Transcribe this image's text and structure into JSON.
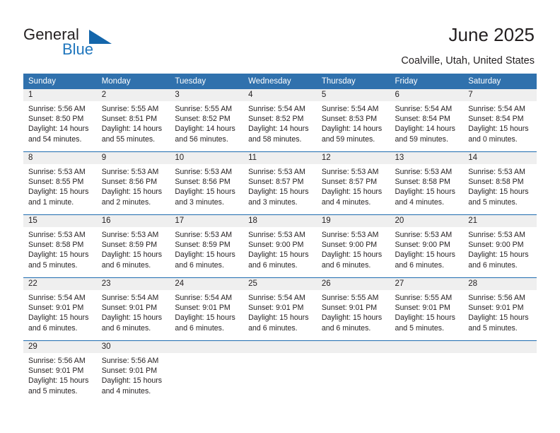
{
  "brand": {
    "name_part1": "General",
    "name_part2": "Blue",
    "triangle_color": "#1466ab",
    "blue_text_color": "#1f76bd"
  },
  "header": {
    "title": "June 2025",
    "location": "Coalville, Utah, United States"
  },
  "theme": {
    "header_row_bg": "#3071ad",
    "header_row_text": "#ffffff",
    "daynum_band_bg": "#efefef",
    "week_separator": "#1f6cb0",
    "body_text": "#231f20"
  },
  "calendar": {
    "weekday_headers": [
      "Sunday",
      "Monday",
      "Tuesday",
      "Wednesday",
      "Thursday",
      "Friday",
      "Saturday"
    ],
    "weeks": [
      [
        {
          "day": "1",
          "sunrise": "Sunrise: 5:56 AM",
          "sunset": "Sunset: 8:50 PM",
          "daylight_line1": "Daylight: 14 hours",
          "daylight_line2": "and 54 minutes."
        },
        {
          "day": "2",
          "sunrise": "Sunrise: 5:55 AM",
          "sunset": "Sunset: 8:51 PM",
          "daylight_line1": "Daylight: 14 hours",
          "daylight_line2": "and 55 minutes."
        },
        {
          "day": "3",
          "sunrise": "Sunrise: 5:55 AM",
          "sunset": "Sunset: 8:52 PM",
          "daylight_line1": "Daylight: 14 hours",
          "daylight_line2": "and 56 minutes."
        },
        {
          "day": "4",
          "sunrise": "Sunrise: 5:54 AM",
          "sunset": "Sunset: 8:52 PM",
          "daylight_line1": "Daylight: 14 hours",
          "daylight_line2": "and 58 minutes."
        },
        {
          "day": "5",
          "sunrise": "Sunrise: 5:54 AM",
          "sunset": "Sunset: 8:53 PM",
          "daylight_line1": "Daylight: 14 hours",
          "daylight_line2": "and 59 minutes."
        },
        {
          "day": "6",
          "sunrise": "Sunrise: 5:54 AM",
          "sunset": "Sunset: 8:54 PM",
          "daylight_line1": "Daylight: 14 hours",
          "daylight_line2": "and 59 minutes."
        },
        {
          "day": "7",
          "sunrise": "Sunrise: 5:54 AM",
          "sunset": "Sunset: 8:54 PM",
          "daylight_line1": "Daylight: 15 hours",
          "daylight_line2": "and 0 minutes."
        }
      ],
      [
        {
          "day": "8",
          "sunrise": "Sunrise: 5:53 AM",
          "sunset": "Sunset: 8:55 PM",
          "daylight_line1": "Daylight: 15 hours",
          "daylight_line2": "and 1 minute."
        },
        {
          "day": "9",
          "sunrise": "Sunrise: 5:53 AM",
          "sunset": "Sunset: 8:56 PM",
          "daylight_line1": "Daylight: 15 hours",
          "daylight_line2": "and 2 minutes."
        },
        {
          "day": "10",
          "sunrise": "Sunrise: 5:53 AM",
          "sunset": "Sunset: 8:56 PM",
          "daylight_line1": "Daylight: 15 hours",
          "daylight_line2": "and 3 minutes."
        },
        {
          "day": "11",
          "sunrise": "Sunrise: 5:53 AM",
          "sunset": "Sunset: 8:57 PM",
          "daylight_line1": "Daylight: 15 hours",
          "daylight_line2": "and 3 minutes."
        },
        {
          "day": "12",
          "sunrise": "Sunrise: 5:53 AM",
          "sunset": "Sunset: 8:57 PM",
          "daylight_line1": "Daylight: 15 hours",
          "daylight_line2": "and 4 minutes."
        },
        {
          "day": "13",
          "sunrise": "Sunrise: 5:53 AM",
          "sunset": "Sunset: 8:58 PM",
          "daylight_line1": "Daylight: 15 hours",
          "daylight_line2": "and 4 minutes."
        },
        {
          "day": "14",
          "sunrise": "Sunrise: 5:53 AM",
          "sunset": "Sunset: 8:58 PM",
          "daylight_line1": "Daylight: 15 hours",
          "daylight_line2": "and 5 minutes."
        }
      ],
      [
        {
          "day": "15",
          "sunrise": "Sunrise: 5:53 AM",
          "sunset": "Sunset: 8:58 PM",
          "daylight_line1": "Daylight: 15 hours",
          "daylight_line2": "and 5 minutes."
        },
        {
          "day": "16",
          "sunrise": "Sunrise: 5:53 AM",
          "sunset": "Sunset: 8:59 PM",
          "daylight_line1": "Daylight: 15 hours",
          "daylight_line2": "and 6 minutes."
        },
        {
          "day": "17",
          "sunrise": "Sunrise: 5:53 AM",
          "sunset": "Sunset: 8:59 PM",
          "daylight_line1": "Daylight: 15 hours",
          "daylight_line2": "and 6 minutes."
        },
        {
          "day": "18",
          "sunrise": "Sunrise: 5:53 AM",
          "sunset": "Sunset: 9:00 PM",
          "daylight_line1": "Daylight: 15 hours",
          "daylight_line2": "and 6 minutes."
        },
        {
          "day": "19",
          "sunrise": "Sunrise: 5:53 AM",
          "sunset": "Sunset: 9:00 PM",
          "daylight_line1": "Daylight: 15 hours",
          "daylight_line2": "and 6 minutes."
        },
        {
          "day": "20",
          "sunrise": "Sunrise: 5:53 AM",
          "sunset": "Sunset: 9:00 PM",
          "daylight_line1": "Daylight: 15 hours",
          "daylight_line2": "and 6 minutes."
        },
        {
          "day": "21",
          "sunrise": "Sunrise: 5:53 AM",
          "sunset": "Sunset: 9:00 PM",
          "daylight_line1": "Daylight: 15 hours",
          "daylight_line2": "and 6 minutes."
        }
      ],
      [
        {
          "day": "22",
          "sunrise": "Sunrise: 5:54 AM",
          "sunset": "Sunset: 9:01 PM",
          "daylight_line1": "Daylight: 15 hours",
          "daylight_line2": "and 6 minutes."
        },
        {
          "day": "23",
          "sunrise": "Sunrise: 5:54 AM",
          "sunset": "Sunset: 9:01 PM",
          "daylight_line1": "Daylight: 15 hours",
          "daylight_line2": "and 6 minutes."
        },
        {
          "day": "24",
          "sunrise": "Sunrise: 5:54 AM",
          "sunset": "Sunset: 9:01 PM",
          "daylight_line1": "Daylight: 15 hours",
          "daylight_line2": "and 6 minutes."
        },
        {
          "day": "25",
          "sunrise": "Sunrise: 5:54 AM",
          "sunset": "Sunset: 9:01 PM",
          "daylight_line1": "Daylight: 15 hours",
          "daylight_line2": "and 6 minutes."
        },
        {
          "day": "26",
          "sunrise": "Sunrise: 5:55 AM",
          "sunset": "Sunset: 9:01 PM",
          "daylight_line1": "Daylight: 15 hours",
          "daylight_line2": "and 6 minutes."
        },
        {
          "day": "27",
          "sunrise": "Sunrise: 5:55 AM",
          "sunset": "Sunset: 9:01 PM",
          "daylight_line1": "Daylight: 15 hours",
          "daylight_line2": "and 5 minutes."
        },
        {
          "day": "28",
          "sunrise": "Sunrise: 5:56 AM",
          "sunset": "Sunset: 9:01 PM",
          "daylight_line1": "Daylight: 15 hours",
          "daylight_line2": "and 5 minutes."
        }
      ],
      [
        {
          "day": "29",
          "sunrise": "Sunrise: 5:56 AM",
          "sunset": "Sunset: 9:01 PM",
          "daylight_line1": "Daylight: 15 hours",
          "daylight_line2": "and 5 minutes."
        },
        {
          "day": "30",
          "sunrise": "Sunrise: 5:56 AM",
          "sunset": "Sunset: 9:01 PM",
          "daylight_line1": "Daylight: 15 hours",
          "daylight_line2": "and 4 minutes."
        },
        {
          "day": "",
          "sunrise": "",
          "sunset": "",
          "daylight_line1": "",
          "daylight_line2": ""
        },
        {
          "day": "",
          "sunrise": "",
          "sunset": "",
          "daylight_line1": "",
          "daylight_line2": ""
        },
        {
          "day": "",
          "sunrise": "",
          "sunset": "",
          "daylight_line1": "",
          "daylight_line2": ""
        },
        {
          "day": "",
          "sunrise": "",
          "sunset": "",
          "daylight_line1": "",
          "daylight_line2": ""
        },
        {
          "day": "",
          "sunrise": "",
          "sunset": "",
          "daylight_line1": "",
          "daylight_line2": ""
        }
      ]
    ]
  }
}
